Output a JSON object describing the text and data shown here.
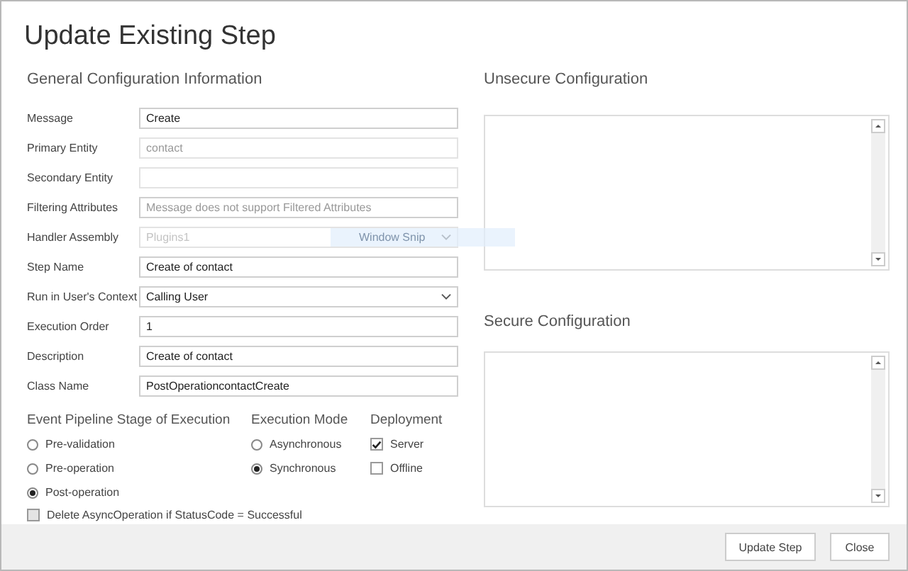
{
  "window": {
    "title": "Update Existing Step"
  },
  "general": {
    "heading": "General Configuration Information",
    "fields": [
      {
        "label": "Message",
        "kind": "text",
        "value": "Create",
        "disabled": false
      },
      {
        "label": "Primary Entity",
        "kind": "text",
        "value": "contact",
        "disabled": true
      },
      {
        "label": "Secondary Entity",
        "kind": "text",
        "disabled": true
      },
      {
        "label": "Filtering Attributes",
        "kind": "text",
        "placeholder": "Message does not support Filtered Attributes",
        "disabled": false
      },
      {
        "label": "Handler Assembly",
        "kind": "select",
        "value": "Plugins1",
        "disabled": true
      },
      {
        "label": "Step Name",
        "kind": "text",
        "value": "Create of contact",
        "disabled": false
      },
      {
        "label": "Run in User's Context",
        "kind": "select",
        "value": "Calling User",
        "disabled": false
      },
      {
        "label": "Execution Order",
        "kind": "text",
        "value": "1",
        "disabled": false
      },
      {
        "label": "Description",
        "kind": "text",
        "value": "Create of contact",
        "disabled": false
      },
      {
        "label": "Class Name",
        "kind": "text",
        "value": "PostOperationcontactCreate",
        "disabled": false
      }
    ]
  },
  "overlay_hint": "Window Snip",
  "stage": {
    "heading": "Event Pipeline Stage of Execution",
    "options": [
      {
        "label": "Pre-validation",
        "selected": false
      },
      {
        "label": "Pre-operation",
        "selected": false
      },
      {
        "label": "Post-operation",
        "selected": true
      }
    ]
  },
  "mode": {
    "heading": "Execution Mode",
    "options": [
      {
        "label": "Asynchronous",
        "selected": false
      },
      {
        "label": "Synchronous",
        "selected": true
      }
    ]
  },
  "deployment": {
    "heading": "Deployment",
    "options": [
      {
        "label": "Server",
        "checked": true
      },
      {
        "label": "Offline",
        "checked": false
      }
    ]
  },
  "delete_async": {
    "label": "Delete AsyncOperation if StatusCode = Successful",
    "checked": false,
    "disabled": true
  },
  "unsecure": {
    "heading": "Unsecure  Configuration"
  },
  "secure": {
    "heading": "Secure  Configuration"
  },
  "buttons": [
    "Update Step",
    "Close"
  ]
}
